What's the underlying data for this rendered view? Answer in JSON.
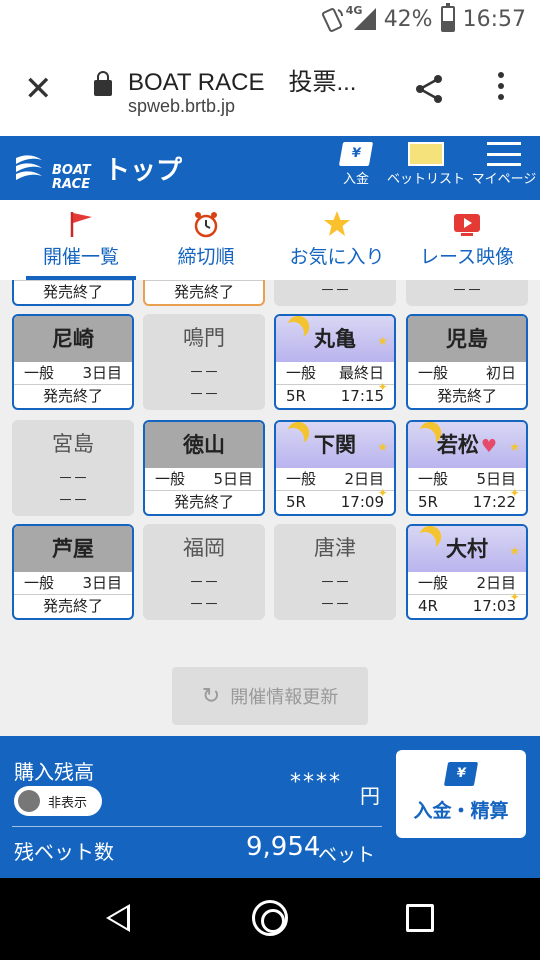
{
  "status_bar": {
    "network": "4G",
    "battery": "42%",
    "time": "16:57"
  },
  "browser": {
    "title": "BOAT RACE　投票...",
    "host": "spweb.brtb.jp"
  },
  "header": {
    "logo_text_1": "BOAT",
    "logo_text_2": "RACE",
    "title": "トップ",
    "buttons": {
      "deposit": "入金",
      "bet_list": "ベットリスト",
      "my_page": "マイページ"
    },
    "deposit_icon_text": "¥"
  },
  "tabs": [
    {
      "label": "開催一覧",
      "icon": "flag-icon",
      "active": true
    },
    {
      "label": "締切順",
      "icon": "alarm-clock-icon",
      "active": false
    },
    {
      "label": "お気に入り",
      "icon": "star-icon",
      "active": false
    },
    {
      "label": "レース映像",
      "icon": "video-play-icon",
      "active": false
    }
  ],
  "partial_row": [
    "発売終了",
    "発売終了",
    "－－",
    "－－"
  ],
  "venues": [
    {
      "name": "尼崎",
      "state": "open",
      "line1_left": "一般",
      "line1_right": "3日目",
      "line2": "発売終了"
    },
    {
      "name": "鳴門",
      "state": "none",
      "line1": "－－",
      "line2": "－－"
    },
    {
      "name": "丸亀",
      "state": "evening",
      "line1_left": "一般",
      "line1_right": "最終日",
      "line2_left": "5R",
      "line2_right": "17:15"
    },
    {
      "name": "児島",
      "state": "open",
      "line1_left": "一般",
      "line1_right": "初日",
      "line2": "発売終了"
    },
    {
      "name": "宮島",
      "state": "none",
      "line1": "－－",
      "line2": "－－"
    },
    {
      "name": "徳山",
      "state": "open",
      "line1_left": "一般",
      "line1_right": "5日目",
      "line2": "発売終了"
    },
    {
      "name": "下関",
      "state": "evening",
      "line1_left": "一般",
      "line1_right": "2日目",
      "line2_left": "5R",
      "line2_right": "17:09"
    },
    {
      "name": "若松",
      "state": "evening",
      "favorite": true,
      "line1_left": "一般",
      "line1_right": "5日目",
      "line2_left": "5R",
      "line2_right": "17:22"
    },
    {
      "name": "芦屋",
      "state": "open",
      "line1_left": "一般",
      "line1_right": "3日目",
      "line2": "発売終了"
    },
    {
      "name": "福岡",
      "state": "none",
      "line1": "－－",
      "line2": "－－"
    },
    {
      "name": "唐津",
      "state": "none",
      "line1": "－－",
      "line2": "－－"
    },
    {
      "name": "大村",
      "state": "evening",
      "line1_left": "一般",
      "line1_right": "2日目",
      "line2_left": "4R",
      "line2_right": "17:03"
    }
  ],
  "refresh_button": "開催情報更新",
  "purchase_panel": {
    "title": "購入残高",
    "toggle_label": "非表示",
    "balance_masked": "****",
    "balance_unit": "円",
    "bets_label": "残ベット数",
    "bets_value": "9,954",
    "bets_unit": "ベット",
    "deposit_button": "入金・精算",
    "deposit_icon_text": "¥"
  },
  "colors": {
    "primary": "#1565c0",
    "closed_head": "#a8a8a8",
    "evening_head": "#c4c0f0",
    "favorite_heart": "#e64a6a"
  }
}
